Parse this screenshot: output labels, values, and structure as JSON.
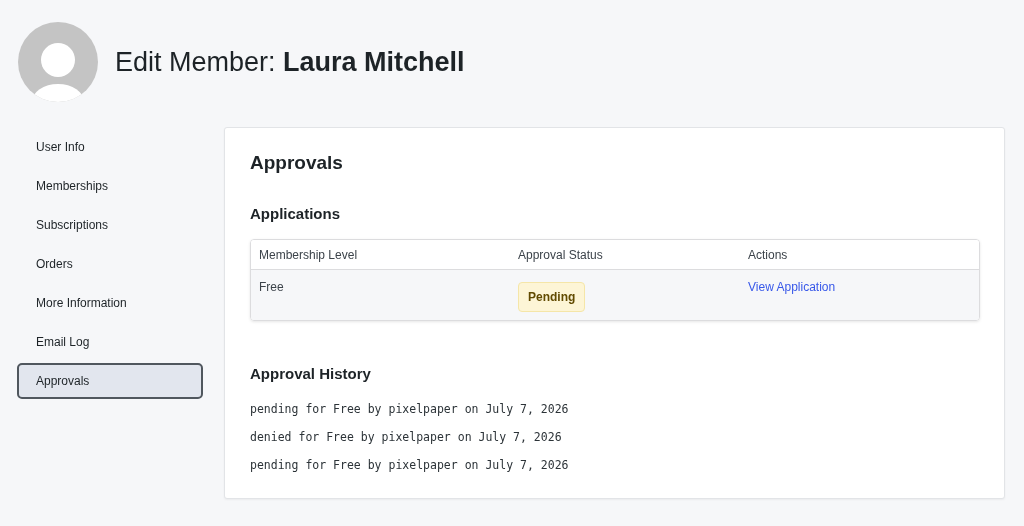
{
  "header": {
    "title": "Edit Member: **Laura Mitchell**"
  },
  "sidebar": {
    "items": [
      {
        "label": "User Info",
        "selected": false
      },
      {
        "label": "Memberships",
        "selected": false
      },
      {
        "label": "Subscriptions",
        "selected": false
      },
      {
        "label": "Orders",
        "selected": false
      },
      {
        "label": "More Information",
        "selected": false
      },
      {
        "label": "Email Log",
        "selected": false
      },
      {
        "label": "Approvals",
        "selected": true
      }
    ]
  },
  "panel": {
    "title": "Approvals",
    "applications": {
      "heading": "Applications",
      "columns": [
        "Membership Level",
        "Approval Status",
        "Actions"
      ],
      "rows": [
        {
          "level": "Free",
          "status": "Pending",
          "action": "View Application"
        }
      ]
    },
    "history": {
      "heading": "Approval History",
      "entries": [
        "pending for Free by pixelpaper on July 7, 2026",
        "denied for Free by pixelpaper on July 7, 2026",
        "pending for Free by pixelpaper on July 7, 2026"
      ]
    }
  }
}
